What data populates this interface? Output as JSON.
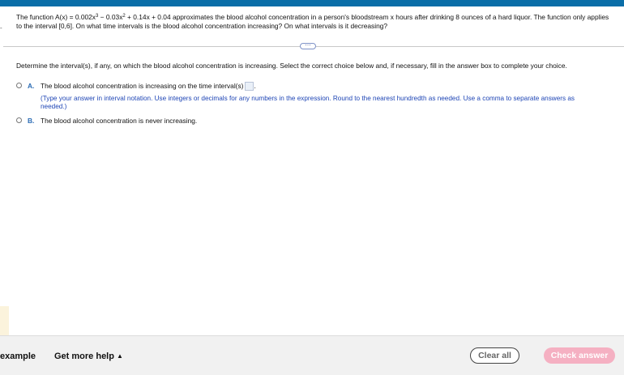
{
  "question": {
    "intro": "The function A(x) = 0.002x",
    "exp1": "3",
    "term2": " − 0.03x",
    "exp2": "2",
    "rest": " + 0.14x + 0.04 approximates the blood alcohol concentration in a person's bloodstream x hours after drinking 8 ounces of a hard liquor. The function only applies to the interval [0,6]. On what time intervals is the blood alcohol concentration increasing? On what intervals is it decreasing?"
  },
  "more_label": "⋯",
  "instruction": "Determine the interval(s), if any, on which the blood alcohol concentration is increasing. Select the correct choice below and, if necessary, fill in the answer box to complete your choice.",
  "choices": [
    {
      "letter": "A.",
      "text": "The blood alcohol concentration is increasing on the time interval(s)",
      "suffix": ".",
      "hint": "(Type your answer in interval notation. Use integers or decimals for any numbers in the expression. Round to the nearest hundredth as needed. Use a comma to separate answers as needed.)"
    },
    {
      "letter": "B.",
      "text": "The blood alcohol concentration is never increasing."
    }
  ],
  "footer": {
    "example_label": "example",
    "help_label": "Get more help",
    "help_caret": "▲",
    "clear_label": "Clear all",
    "check_label": "Check answer"
  },
  "colors": {
    "accent_bar": "#0a6ea8",
    "choice_letter": "#2a6bb4",
    "hint_text": "#1e45b5",
    "check_button": "#f5b0c2"
  }
}
